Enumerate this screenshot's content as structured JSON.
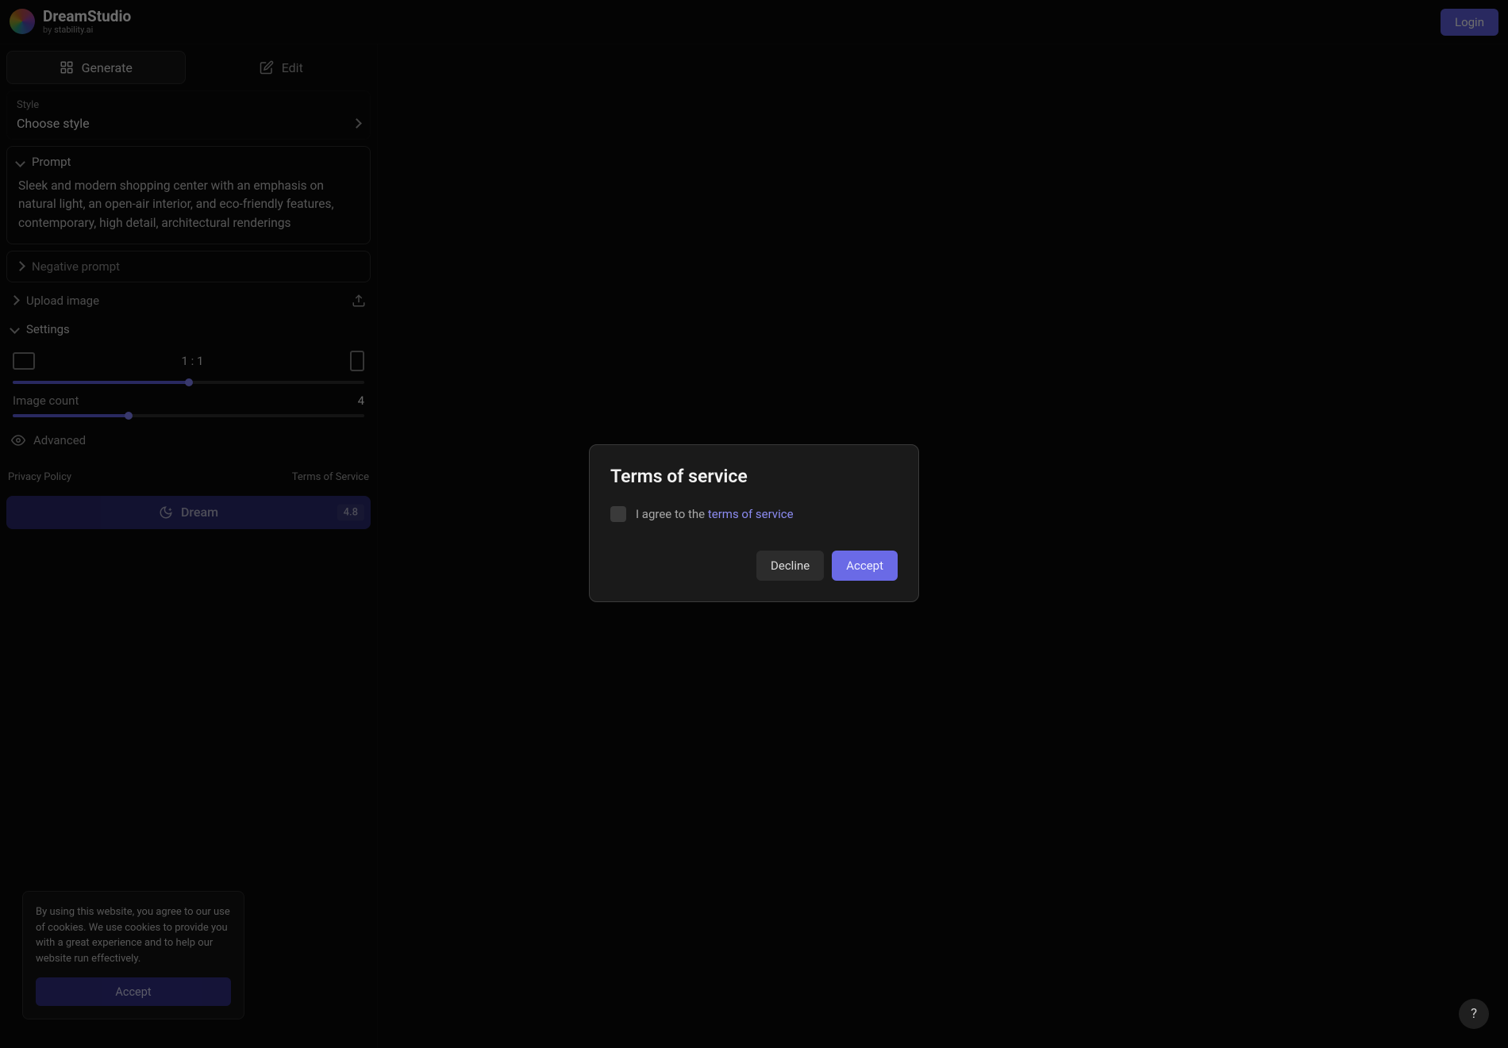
{
  "header": {
    "brand_title": "DreamStudio",
    "brand_by": "by",
    "brand_sub": "stability.ai",
    "login_label": "Login"
  },
  "tabs": {
    "generate": "Generate",
    "edit": "Edit"
  },
  "style": {
    "label": "Style",
    "value": "Choose style"
  },
  "prompt": {
    "label": "Prompt",
    "text": "Sleek and modern shopping center with an emphasis on natural light, an open-air interior, and eco-friendly features, contemporary, high detail, architectural renderings"
  },
  "negative_prompt": {
    "label": "Negative prompt"
  },
  "upload": {
    "label": "Upload image"
  },
  "settings": {
    "label": "Settings",
    "aspect_ratio": "1 : 1",
    "image_count_label": "Image count",
    "image_count_value": "4",
    "advanced": "Advanced"
  },
  "links": {
    "privacy": "Privacy Policy",
    "tos": "Terms of Service"
  },
  "dream": {
    "label": "Dream",
    "cost": "4.8"
  },
  "cookie": {
    "text": "By using this website, you agree to our use of cookies. We use cookies to provide you with a great experience and to help our website run effectively.",
    "accept": "Accept"
  },
  "modal": {
    "title": "Terms of service",
    "agree_prefix": "I agree to the ",
    "agree_link": "terms of service",
    "decline": "Decline",
    "accept": "Accept"
  },
  "help": {
    "label": "?"
  }
}
